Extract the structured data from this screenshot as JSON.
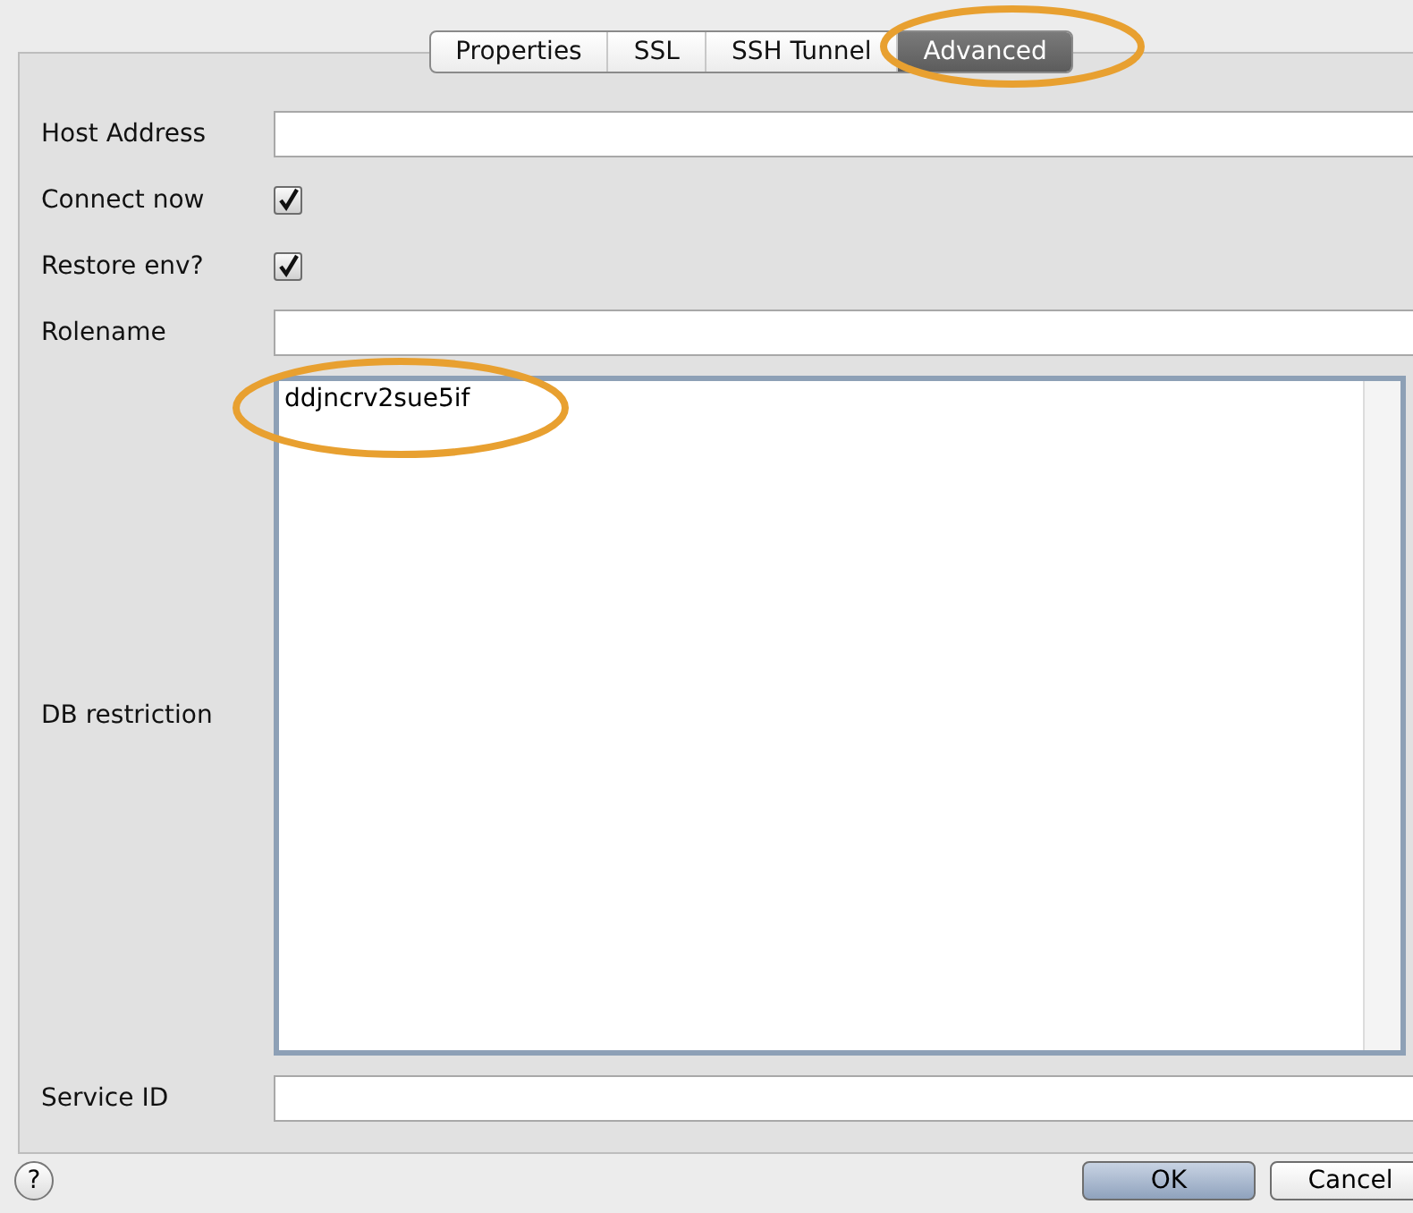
{
  "tabs": [
    {
      "label": "Properties",
      "selected": false
    },
    {
      "label": "SSL",
      "selected": false
    },
    {
      "label": "SSH Tunnel",
      "selected": false
    },
    {
      "label": "Advanced",
      "selected": true
    }
  ],
  "fields": [
    {
      "kind": "text",
      "label": "Host Address"
    },
    {
      "kind": "checkbox",
      "label": "Connect now",
      "checked": true
    },
    {
      "kind": "checkbox",
      "label": "Restore env?",
      "checked": true
    },
    {
      "kind": "text",
      "label": "Rolename"
    },
    {
      "kind": "textarea",
      "label": "DB restriction",
      "value": "ddjncrv2sue5if"
    },
    {
      "kind": "text",
      "label": "Service ID"
    }
  ],
  "help": {
    "label": "?"
  },
  "buttons": [
    {
      "label": "OK",
      "default": true
    },
    {
      "label": "Cancel",
      "default": false
    }
  ]
}
